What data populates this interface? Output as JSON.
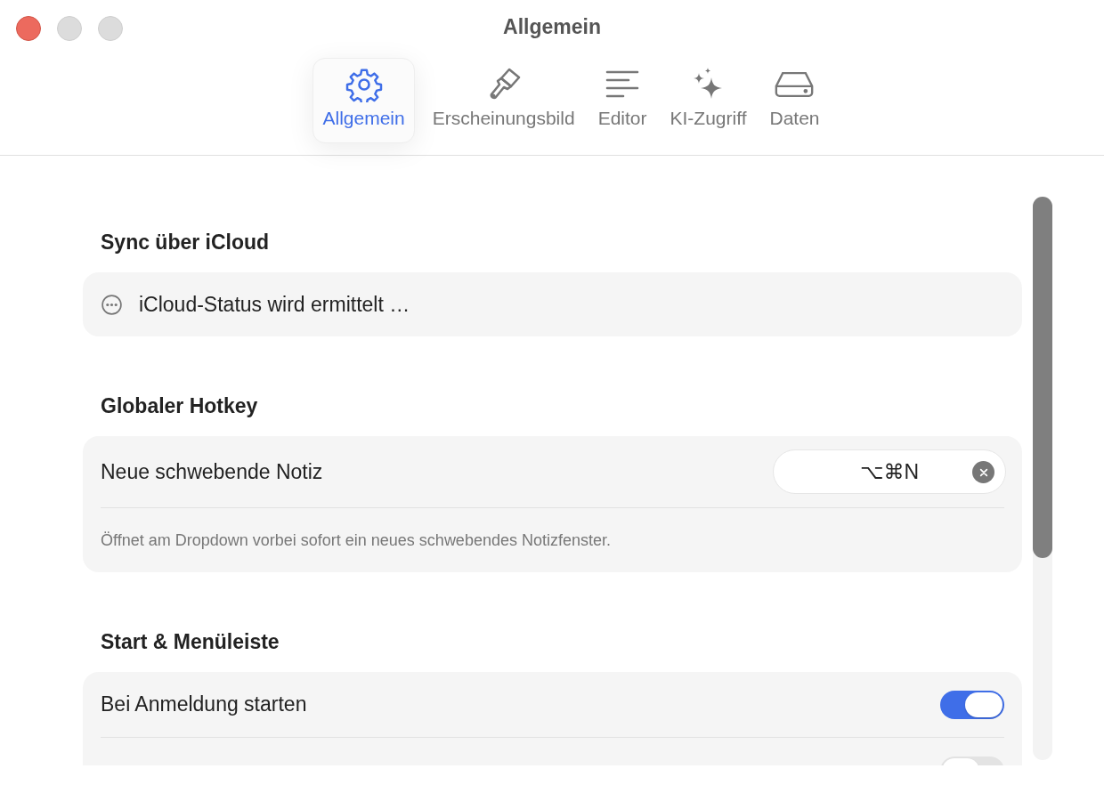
{
  "window": {
    "title": "Allgemein"
  },
  "tabs": [
    {
      "label": "Allgemein",
      "selected": true
    },
    {
      "label": "Erscheinungsbild",
      "selected": false
    },
    {
      "label": "Editor",
      "selected": false
    },
    {
      "label": "KI-Zugriff",
      "selected": false
    },
    {
      "label": "Daten",
      "selected": false
    }
  ],
  "sections": [
    {
      "title": "Sync über iCloud",
      "rows": [
        {
          "kind": "status",
          "label": "iCloud-Status wird ermittelt …"
        }
      ]
    },
    {
      "title": "Globaler Hotkey",
      "rows": [
        {
          "kind": "hotkey",
          "label": "Neue schwebende Notiz",
          "value": "⌥⌘N"
        },
        {
          "kind": "note",
          "label": "Öffnet am Dropdown vorbei sofort ein neues schwebendes Notizfenster."
        }
      ]
    },
    {
      "title": "Start & Menüleiste",
      "rows": [
        {
          "kind": "toggle",
          "label": "Bei Anmeldung starten",
          "on": true
        },
        {
          "kind": "toggle",
          "on": false
        }
      ]
    }
  ]
}
